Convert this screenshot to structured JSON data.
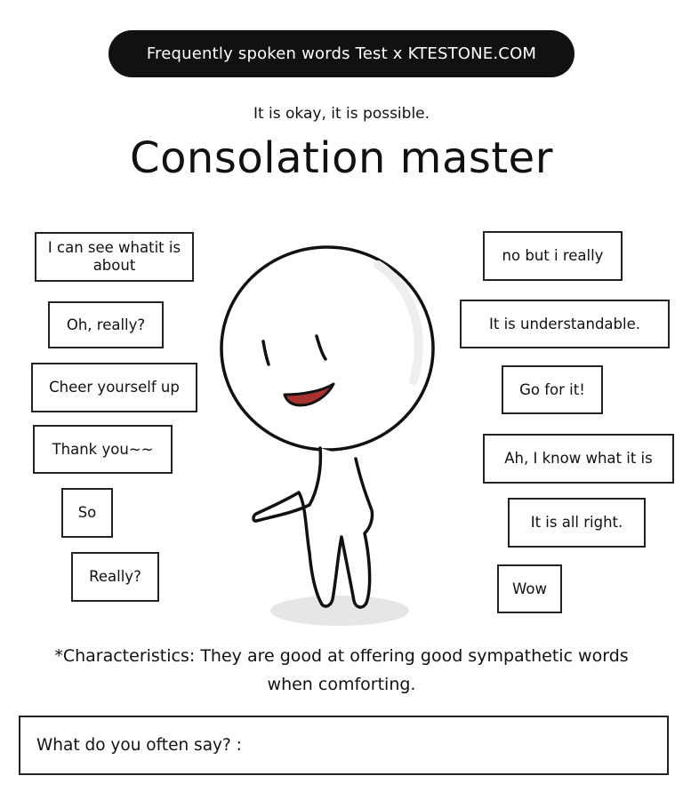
{
  "header": {
    "banner": "Frequently spoken words Test x KTESTONE.COM"
  },
  "result": {
    "subtitle": "It is okay, it is possible.",
    "title": "Consolation master"
  },
  "words_left": [
    "I can see whatit is about",
    "Oh, really?",
    "Cheer yourself up",
    "Thank you~~",
    "So",
    "Really?"
  ],
  "words_right": [
    "no but i really",
    "It is understandable.",
    "Go for it!",
    "Ah, I know what it is",
    "It is all right.",
    "Wow"
  ],
  "characteristics": "*Characteristics: They are good at offering good sympathetic words when comforting.",
  "question": {
    "label": "What do you often say? :"
  },
  "colors": {
    "banner_bg": "#111111",
    "mouth": "#a8322f"
  },
  "illustration": "smiling-stick-figure"
}
